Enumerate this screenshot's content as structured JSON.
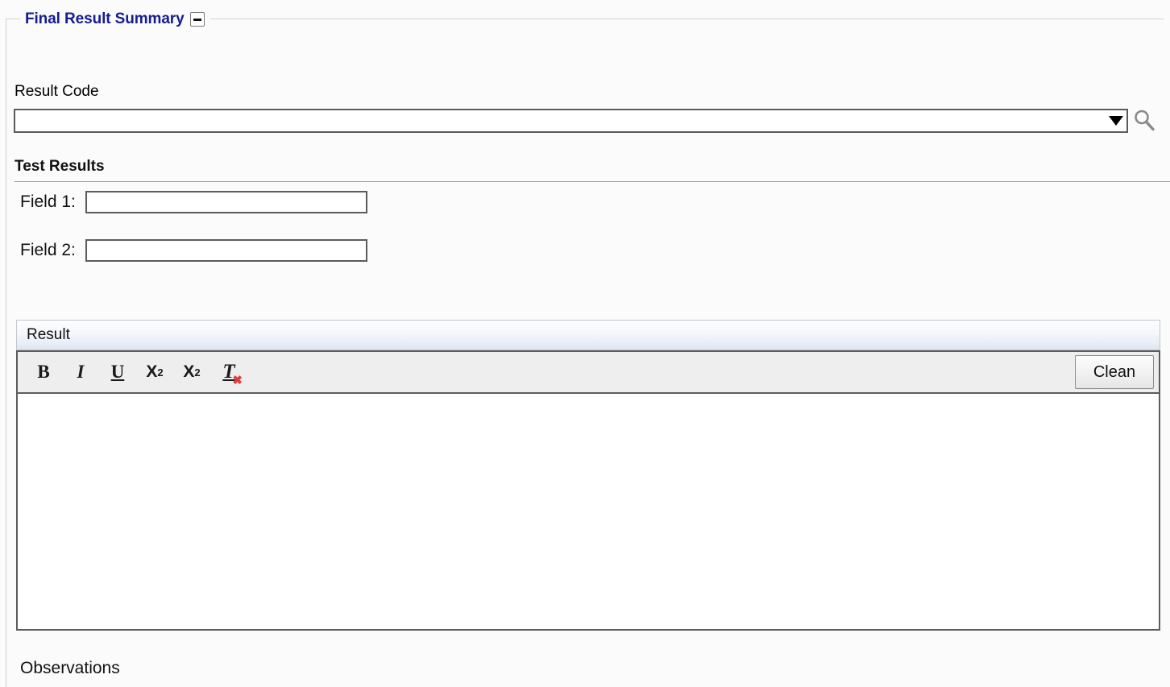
{
  "panel": {
    "legend": "Final Result Summary",
    "collapse_icon": "minus-icon",
    "legend_color": "#161c91"
  },
  "result_code": {
    "label": "Result Code",
    "value": "",
    "placeholder": "",
    "dropdown_icon": "chevron-down-icon",
    "search_icon": "search-icon"
  },
  "test_results": {
    "heading": "Test Results",
    "fields": [
      {
        "label": "Field 1:",
        "value": "",
        "placeholder": ""
      },
      {
        "label": "Field 2:",
        "value": "",
        "placeholder": ""
      }
    ]
  },
  "result_editor": {
    "title": "Result",
    "toolbar": {
      "bold": "B",
      "italic": "I",
      "underline": "U",
      "subscript_base": "X",
      "subscript_mark": "2",
      "superscript_base": "X",
      "superscript_mark": "2",
      "remove_format": "T",
      "remove_format_mark": "✖",
      "clean_label": "Clean"
    },
    "content": ""
  },
  "observations": {
    "label": "Observations"
  }
}
